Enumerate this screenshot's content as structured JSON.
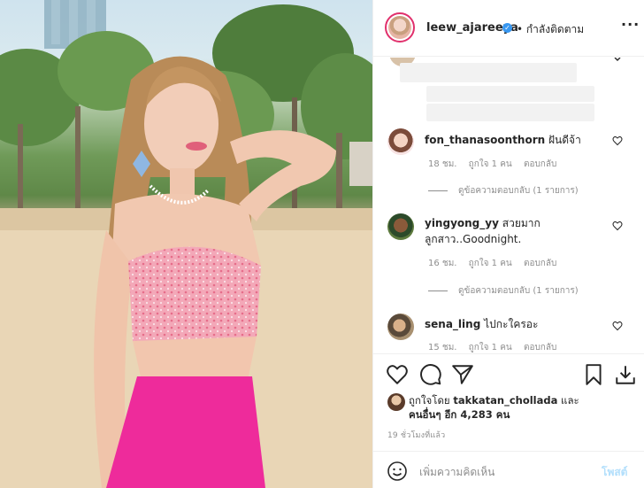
{
  "header": {
    "username": "leew_ajareeya",
    "verified_mark": "✓",
    "follow_status": "• กำลังติดตาม",
    "more_glyph": "···"
  },
  "comments": [
    {
      "username": "fon_thanasoonthorn",
      "text": "ฝันดีจ้า",
      "time": "18 ชม.",
      "likes": "ถูกใจ 1 คน",
      "reply": "ตอบกลับ",
      "view_replies": "ดูข้อความตอบกลับ (1 รายการ)"
    },
    {
      "username": "yingyong_yy",
      "text": "สวยมาก",
      "text_line2": "ลูกสาว..Goodnight.",
      "time": "16 ชม.",
      "likes": "ถูกใจ 1 คน",
      "reply": "ตอบกลับ",
      "view_replies": "ดูข้อความตอบกลับ (1 รายการ)"
    },
    {
      "username": "sena_ling",
      "text": "ไปกะใครอะ",
      "time": "15 ชม.",
      "likes": "ถูกใจ 1 คน",
      "reply": "ตอบกลับ"
    }
  ],
  "likes_summary": {
    "prefix": "ถูกใจโดย",
    "user": "takkatan_chollada",
    "and": "และ",
    "others": "คนอื่นๆ อีก 4,283 คน"
  },
  "post_time": "19 ชั่วโมงที่แล้ว",
  "comment_box": {
    "placeholder": "เพิ่มความคิดเห็น",
    "post_label": "โพสต์"
  },
  "icons": [
    "heart-icon",
    "comment-icon",
    "share-icon",
    "bookmark-icon",
    "download-icon",
    "emoji-icon",
    "verified-icon"
  ],
  "colors": {
    "accent": "#3897f0",
    "post_disabled": "#b2dffc",
    "muted": "#8e8e8e",
    "text": "#262626"
  }
}
